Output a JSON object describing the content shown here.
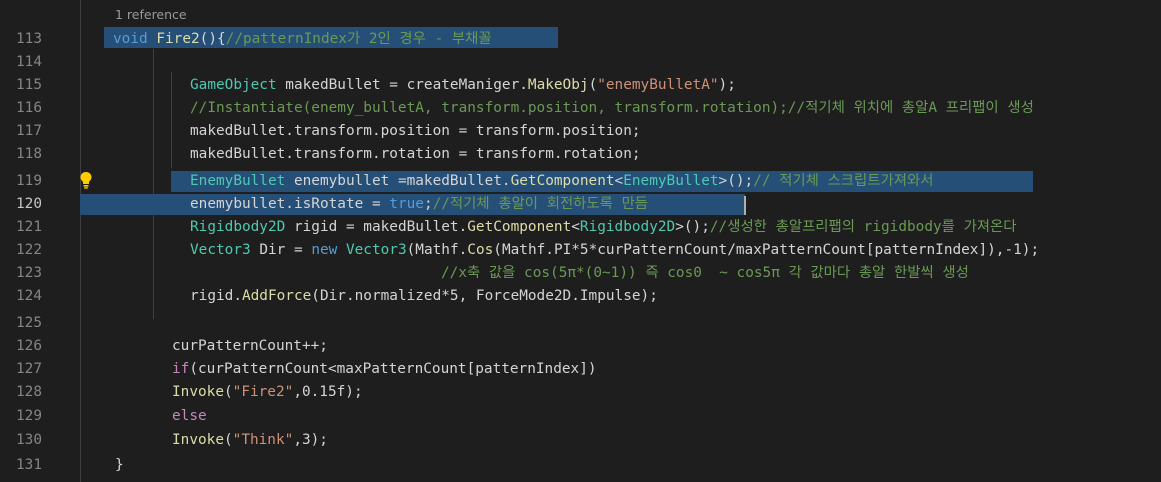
{
  "codelens": "1 reference",
  "line_numbers": [
    "113",
    "114",
    "115",
    "116",
    "117",
    "118",
    "119",
    "120",
    "121",
    "122",
    "123",
    "124",
    "125",
    "126",
    "127",
    "128",
    "129",
    "130",
    "131"
  ],
  "code": {
    "l113": {
      "kw_void": "void",
      "fn": "Fire2",
      "paren": "(){",
      "comment": "//patternIndex가 2인 경우 - 부채꼴"
    },
    "l115": {
      "type": "GameObject",
      "rest1": " makedBullet = createManiger.",
      "fn": "MakeObj",
      "p1": "(",
      "str": "\"enemyBulletA\"",
      "p2": ");"
    },
    "l116": {
      "comment": "//Instantiate(enemy_bulletA, transform.position, transform.rotation);//적기체 위치에 총알A 프리팹이 생성"
    },
    "l117": {
      "text": "makedBullet.transform.position = transform.position;"
    },
    "l118": {
      "text": "makedBullet.transform.rotation = transform.rotation;"
    },
    "l119": {
      "type": "EnemyBullet",
      "rest1": " enemybullet =makedBullet.",
      "fn": "GetComponent",
      "lt": "<",
      "type2": "EnemyBullet",
      "gt": ">();",
      "comment": "// 적기체 스크립트가져와서"
    },
    "l120": {
      "rest1": "enemybullet.isRotate = ",
      "kw": "true",
      "semi": ";",
      "comment": "//적기체 총알이 회전하도록 만듬"
    },
    "l121": {
      "type": "Rigidbody2D",
      "rest1": " rigid = makedBullet.",
      "fn": "GetComponent",
      "lt": "<",
      "type2": "Rigidbody2D",
      "gt": ">();",
      "comment": "//생성한 총알프리팹의 rigidbody를 가져온다"
    },
    "l122": {
      "type": "Vector3",
      "rest1": " Dir = ",
      "kw": "new",
      "sp": " ",
      "type2": "Vector3",
      "rest2": "(Mathf.",
      "fn": "Cos",
      "rest3": "(Mathf.PI*5*curPatternCount/maxPatternCount[patternIndex]),-1);"
    },
    "l123": {
      "comment": "//x축 값을 cos(5π*(0~1)) 즉 cos0  ~ cos5π 각 값마다 총알 한발씩 생성"
    },
    "l124": {
      "rest1": "rigid.",
      "fn": "AddForce",
      "rest2": "(Dir.normalized*5, ForceMode2D.Impulse);"
    },
    "l126": {
      "text": "curPatternCount++;"
    },
    "l127": {
      "kw": "if",
      "rest1": "(curPatternCount<maxPatternCount[patternIndex])"
    },
    "l128": {
      "fn": "Invoke",
      "p1": "(",
      "str": "\"Fire2\"",
      "rest1": ",0.15f);"
    },
    "l129": {
      "kw": "else"
    },
    "l130": {
      "fn": "Invoke",
      "p1": "(",
      "str": "\"Think\"",
      "rest1": ",3);"
    },
    "l131": {
      "text": "}"
    }
  },
  "lightbulb_icon": "lightbulb-icon"
}
